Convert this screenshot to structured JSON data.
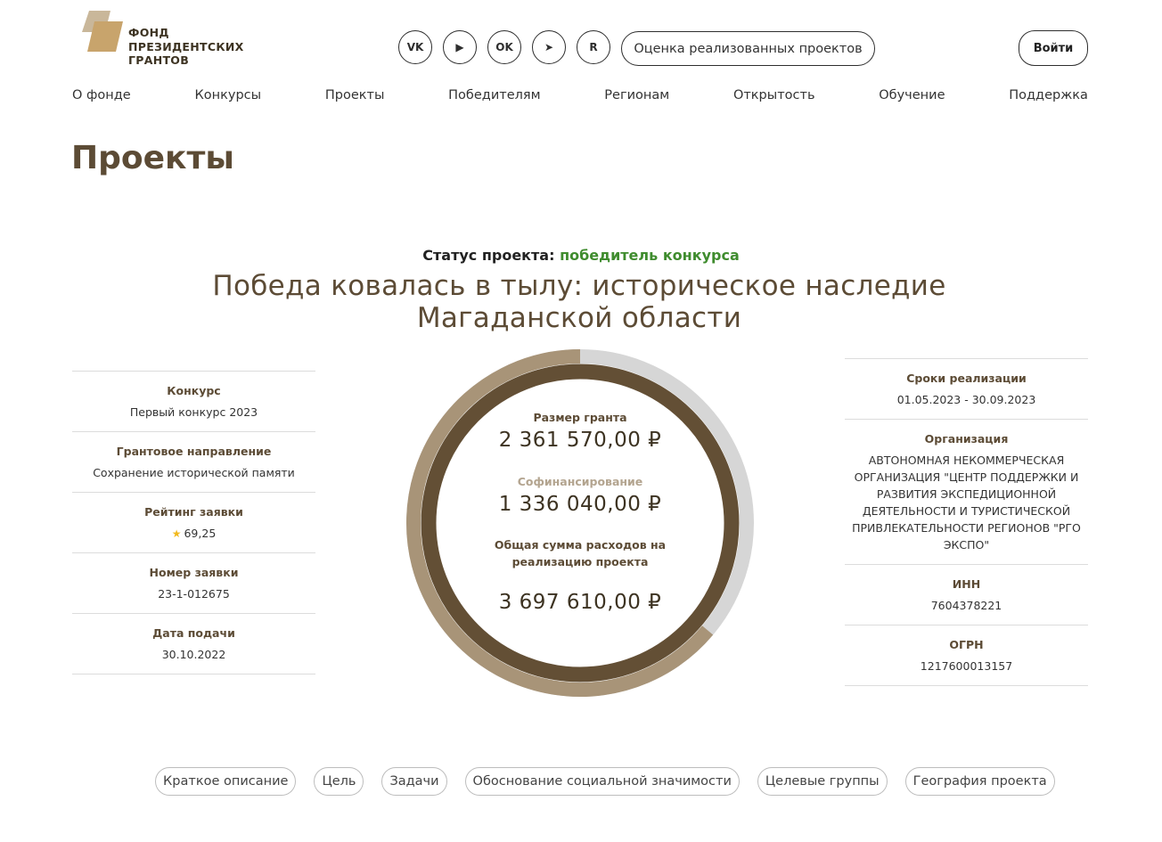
{
  "header": {
    "logo_text": "ФОНД\nПРЕЗИДЕНТСКИХ\nГРАНТОВ",
    "social": [
      {
        "icon": "vk-icon",
        "glyph": "VK"
      },
      {
        "icon": "youtube-icon",
        "glyph": "▶"
      },
      {
        "icon": "odnoklassniki-icon",
        "glyph": "OK"
      },
      {
        "icon": "telegram-icon",
        "glyph": "➤"
      },
      {
        "icon": "rutube-icon",
        "glyph": "R"
      }
    ],
    "eval_button": "Оценка реализованных проектов",
    "login_button": "Войти"
  },
  "nav": [
    "О фонде",
    "Конкурсы",
    "Проекты",
    "Победителям",
    "Регионам",
    "Открытость",
    "Обучение",
    "Поддержка"
  ],
  "page_title": "Проекты",
  "status": {
    "label": "Статус проекта:",
    "value": "победитель конкурса"
  },
  "project_title": "Победа ковалась в тылу: историческое наследие Магаданской области",
  "left_info": [
    {
      "label": "Конкурс",
      "value": "Первый конкурс 2023"
    },
    {
      "label": "Грантовое направление",
      "value": "Сохранение исторической памяти"
    },
    {
      "label": "Рейтинг заявки",
      "value": "69,25",
      "star": true
    },
    {
      "label": "Номер заявки",
      "value": "23-1-012675"
    },
    {
      "label": "Дата подачи",
      "value": "30.10.2022"
    }
  ],
  "right_info": [
    {
      "label": "Сроки реализации",
      "value": "01.05.2023 - 30.09.2023"
    },
    {
      "label": "Организация",
      "value": "АВТОНОМНАЯ НЕКОММЕРЧЕСКАЯ ОРГАНИЗАЦИЯ \"ЦЕНТР ПОДДЕРЖКИ И РАЗВИТИЯ ЭКСПЕДИЦИОННОЙ ДЕЯТЕЛЬНОСТИ И ТУРИСТИЧЕСКОЙ ПРИВЛЕКАТЕЛЬНОСТИ РЕГИОНОВ \"РГО ЭКСПО\"",
      "tall": true
    },
    {
      "label": "ИНН",
      "value": "7604378221"
    },
    {
      "label": "ОГРН",
      "value": "1217600013157"
    }
  ],
  "finance": {
    "grant_label": "Размер гранта",
    "grant_value": "2 361 570,00 ₽",
    "cofin_label": "Софинансирование",
    "cofin_value": "1 336 040,00 ₽",
    "total_label": "Общая сумма расходов на реализацию проекта",
    "total_value": "3 697 610,00 ₽",
    "grant_amount": 2361570,
    "cofin_amount": 1336040,
    "colors": {
      "outer_grant": "#a89478",
      "outer_rest": "#d6d6d6",
      "inner": "#634f35"
    }
  },
  "tabs": [
    "Краткое описание",
    "Цель",
    "Задачи",
    "Обоснование социальной значимости",
    "Целевые группы",
    "География проекта"
  ]
}
